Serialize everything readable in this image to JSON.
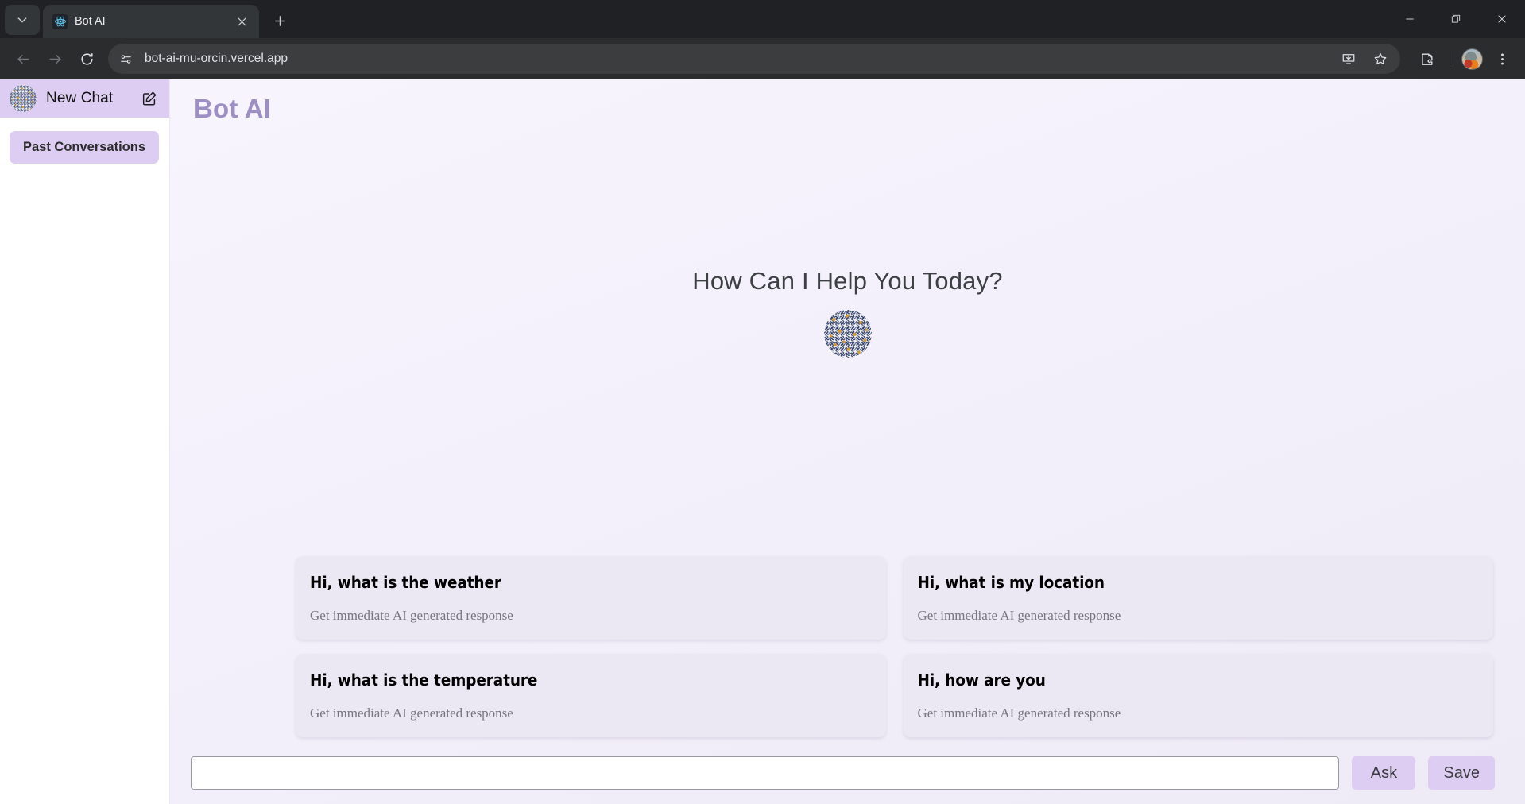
{
  "browser": {
    "tab": {
      "title": "Bot AI",
      "favicon": "react-logo-icon"
    },
    "tab_search_label": "Search tabs",
    "new_tab_label": "New tab",
    "close_tab_label": "Close",
    "url": "bot-ai-mu-orcin.vercel.app",
    "nav": {
      "back": "Back",
      "forward": "Forward",
      "reload": "Reload",
      "site_info": "View site information"
    },
    "actions": {
      "install": "Install page as app",
      "bookmark": "Bookmark this tab",
      "extensions": "Extensions",
      "profile": "Profile",
      "menu": "Customize and control Google Chrome"
    },
    "window": {
      "minimize": "Minimize",
      "maximize": "Restore",
      "close": "Close"
    }
  },
  "sidebar": {
    "new_chat_label": "New Chat",
    "edit_icon": "edit-square-pencil-icon",
    "logo_icon": "bot-avatar-icon",
    "past_conversations_label": "Past Conversations"
  },
  "main": {
    "app_title": "Bot AI",
    "hero_question": "How Can I Help You Today?",
    "hero_logo_icon": "bot-avatar-icon",
    "cards": [
      {
        "title": "Hi, what is the weather",
        "subtitle": "Get immediate AI generated response"
      },
      {
        "title": "Hi, what is my location",
        "subtitle": "Get immediate AI generated response"
      },
      {
        "title": "Hi, what is the temperature",
        "subtitle": "Get immediate AI generated response"
      },
      {
        "title": "Hi, how are you",
        "subtitle": "Get immediate AI generated response"
      }
    ],
    "composer": {
      "input_value": "",
      "input_placeholder": "",
      "ask_label": "Ask",
      "save_label": "Save"
    }
  },
  "colors": {
    "accent_purple": "#ddcdf2",
    "app_title_purple": "#9d8ec4",
    "page_bg": "#f4f0fb",
    "card_bg": "#ebe8f3",
    "chrome_dark": "#202124"
  }
}
